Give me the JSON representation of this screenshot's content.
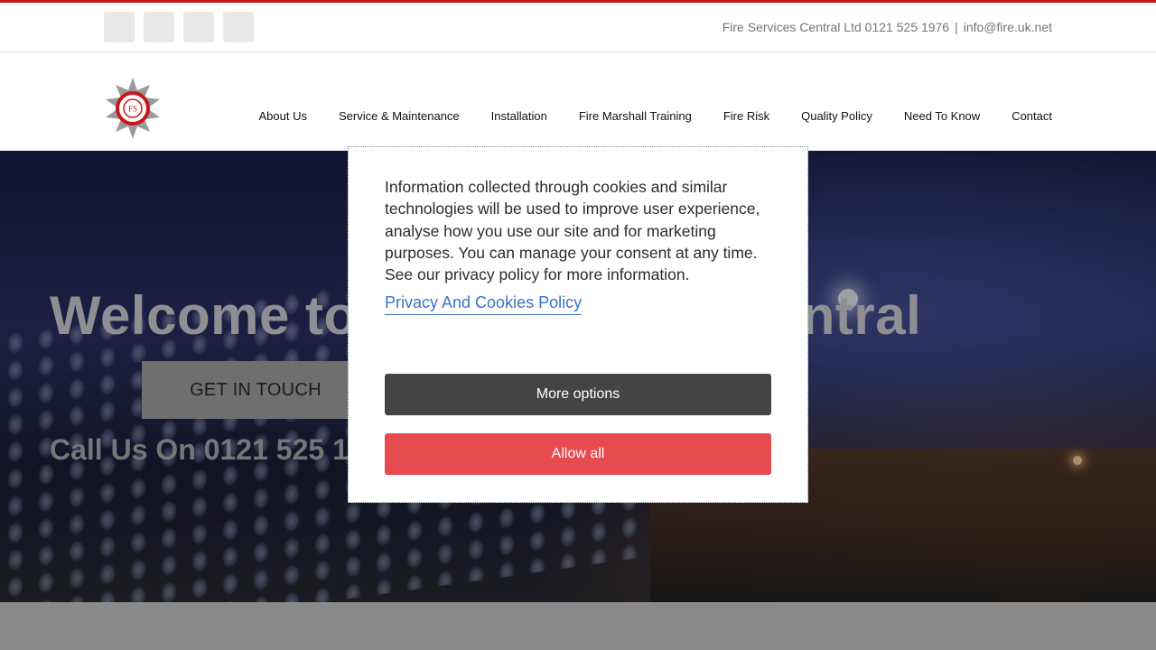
{
  "topbar": {
    "social_icons": [
      "social-icon-1",
      "social-icon-2",
      "social-icon-3",
      "social-icon-4"
    ],
    "company_phone": "Fire Services Central Ltd 0121 525 1976",
    "separator": "|",
    "email": "info@fire.uk.net"
  },
  "header": {
    "logo_icon": "fire-services-badge-icon",
    "nav": [
      {
        "label": "About Us"
      },
      {
        "label": "Service & Maintenance"
      },
      {
        "label": "Installation"
      },
      {
        "label": "Fire Marshall Training"
      },
      {
        "label": "Fire Risk"
      },
      {
        "label": "Quality Policy"
      },
      {
        "label": "Need To Know"
      },
      {
        "label": "Contact"
      }
    ]
  },
  "hero": {
    "title": "Welcome to Fire Services Central",
    "cta_label": "GET IN TOUCH",
    "call_text": "Call Us On 0121 525 1976"
  },
  "cookie": {
    "message": "Information collected through cookies and similar technologies will be used to improve user experience, analyse how you use our site and for marketing purposes. You can manage your consent at any time. See our privacy policy for more information.",
    "policy_link": "Privacy And Cookies Policy",
    "more_options": "More options",
    "allow_all": "Allow all"
  },
  "colors": {
    "accent_red": "#c8161d",
    "allow_button": "#e54b4f",
    "more_button": "#444444",
    "link_blue": "#3b73c5"
  }
}
